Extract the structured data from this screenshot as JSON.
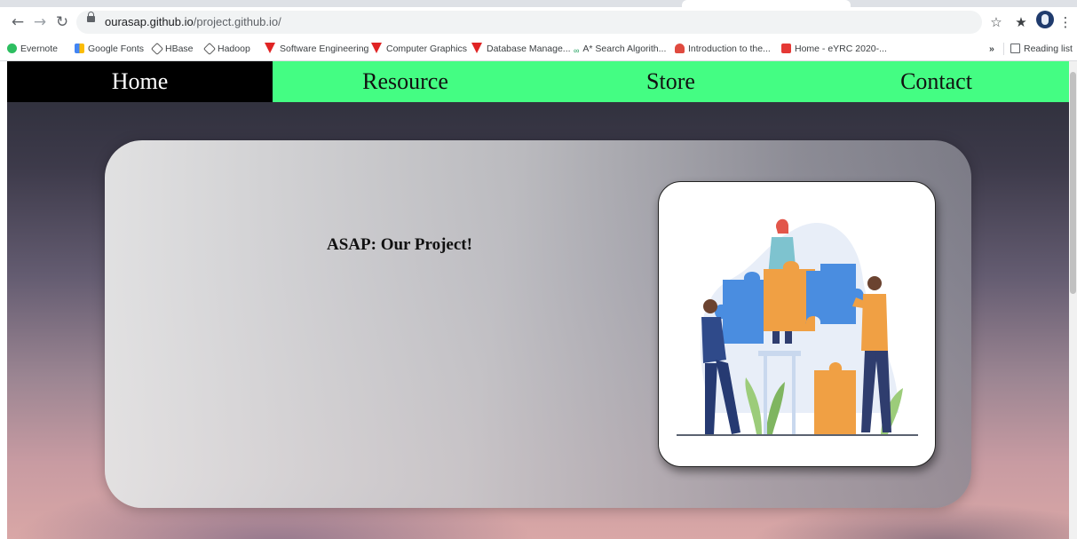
{
  "browser": {
    "nav": {
      "back_icon": "arrow-left-icon",
      "forward_icon": "arrow-right-icon",
      "reload_icon": "reload-icon"
    },
    "url": {
      "host": "ourasap.github.io",
      "path": "/project.github.io/"
    },
    "bookmarks": [
      "Evernote",
      "Google Fonts",
      "HBase",
      "Hadoop",
      "Software Engineering",
      "Computer Graphics",
      "Database Manage...",
      "A* Search Algorith...",
      "Introduction to the...",
      "Home - eYRC 2020-..."
    ],
    "more_bookmarks": "»",
    "reading_list": "Reading list"
  },
  "site": {
    "nav": [
      {
        "label": "Home",
        "active": true
      },
      {
        "label": "Resource",
        "active": false
      },
      {
        "label": "Store",
        "active": false
      },
      {
        "label": "Contact",
        "active": false
      }
    ],
    "hero": {
      "title": "ASAP: Our Project!",
      "image_icon": "teamwork-puzzle-illustration"
    },
    "colors": {
      "nav_bg": "#44fd83",
      "nav_active_bg": "#000000"
    }
  }
}
